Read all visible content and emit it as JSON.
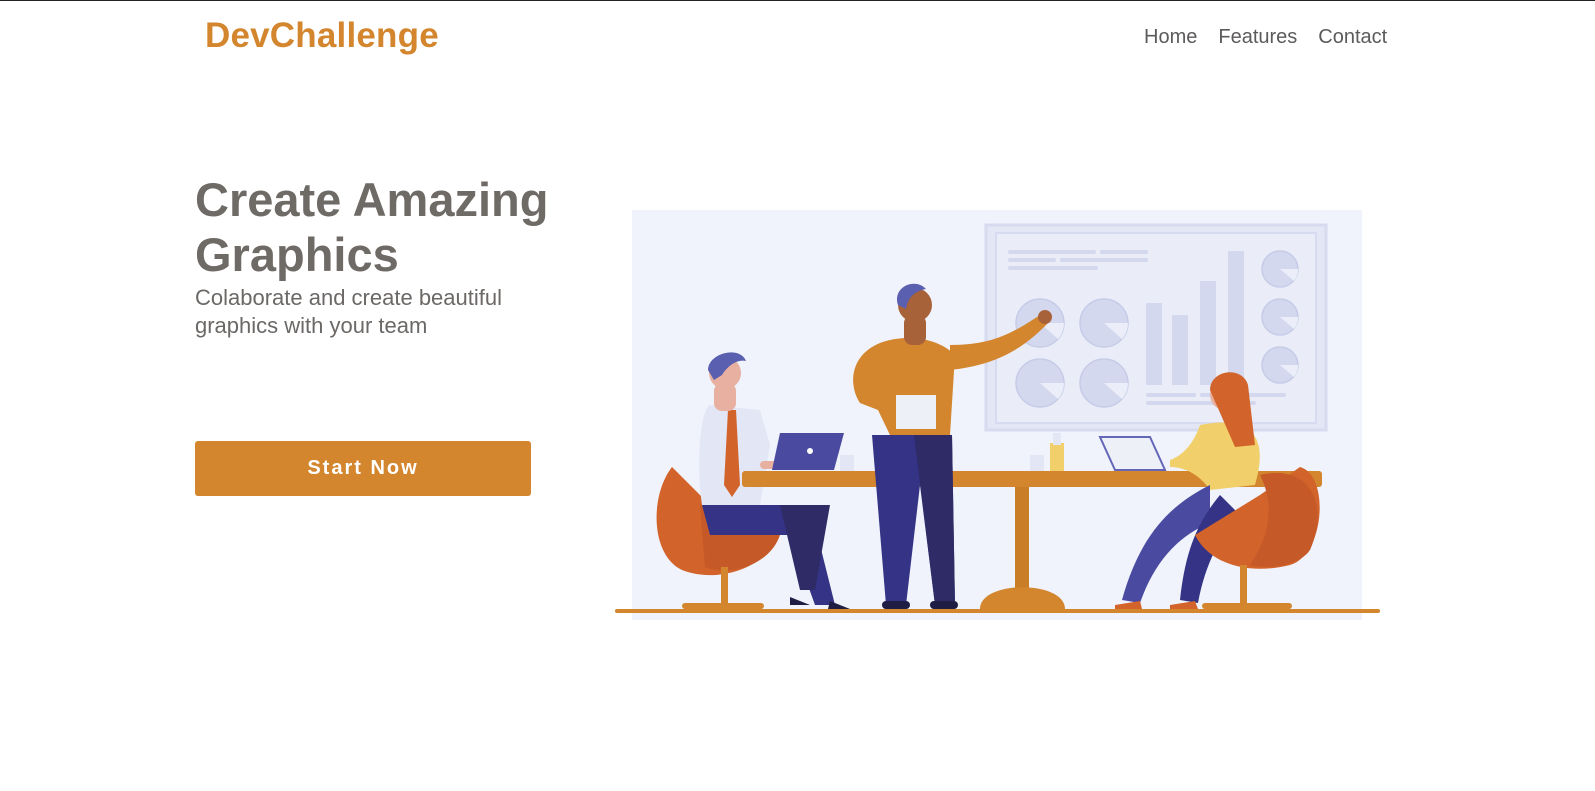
{
  "header": {
    "brand": "DevChallenge",
    "nav": [
      {
        "label": "Home"
      },
      {
        "label": "Features"
      },
      {
        "label": "Contact"
      }
    ]
  },
  "hero": {
    "title": "Create Amazing Graphics",
    "subtitle": "Colaborate and create beautiful graphics with your team",
    "cta_label": "Start Now"
  },
  "colors": {
    "brand": "#d3862e",
    "text": "#6e6a66",
    "illustration_bg": "#f0f3fb",
    "navy": "#343386",
    "orange_chair": "#d2632a"
  },
  "illustration": {
    "icon": "team-meeting-illustration"
  }
}
